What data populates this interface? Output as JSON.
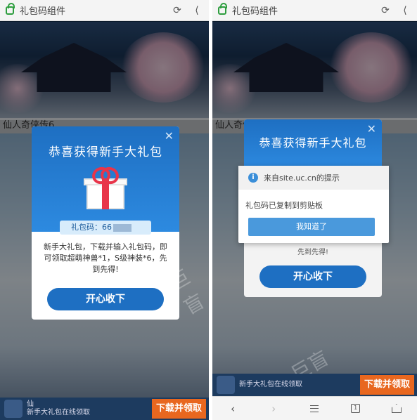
{
  "topbar": {
    "title": "礼包码组件"
  },
  "game": {
    "name": "仙人奇侠传6"
  },
  "watermark": "巨盲",
  "modal": {
    "title": "恭喜获得新手大礼包",
    "code_label": "礼包码：66",
    "desc": "新手大礼包，下载并输入礼包码，即可领取超萌神兽*1，S级神装*6，先到先得!",
    "button": "开心收下",
    "tail_text": "先到先得!"
  },
  "bottom": {
    "name": "仙",
    "subtitle": "新手大礼包在线领取",
    "download": "下载并领取"
  },
  "alert": {
    "header": "来自site.uc.cn的提示",
    "message": "礼包码已复制到剪贴板",
    "button": "我知道了"
  },
  "nav": {
    "back": "‹",
    "forward": "›"
  }
}
